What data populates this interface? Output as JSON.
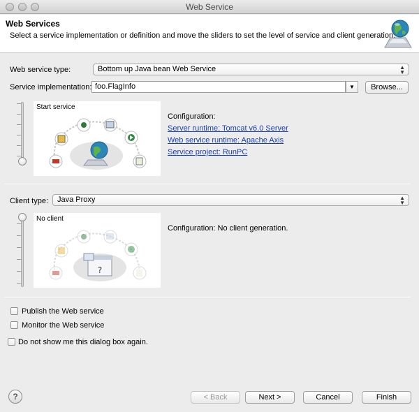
{
  "window": {
    "title": "Web Service",
    "colors": {
      "link": "#1a3fb5",
      "banner_bg": "#ffffff",
      "dialog_bg": "#ececec"
    }
  },
  "banner": {
    "title": "Web Services",
    "description": "Select a service implementation or definition and move the sliders to set the level of service and client generation.",
    "icon": "web-services-globe-icon"
  },
  "service": {
    "type_label": "Web service type:",
    "type_value": "Bottom up Java bean Web Service",
    "impl_label": "Service implementation:",
    "impl_value": "foo.FlagInfo",
    "browse_label": "Browse...",
    "slider_level": "Start service",
    "config_heading": "Configuration:",
    "server_runtime": "Server runtime: Tomcat v6.0 Server",
    "ws_runtime": "Web service runtime: Apache Axis",
    "service_project": "Service project: RunPC"
  },
  "client": {
    "type_label": "Client type:",
    "type_value": "Java Proxy",
    "slider_level": "No client",
    "config_text": "Configuration: No client generation."
  },
  "options": {
    "publish": "Publish the Web service",
    "monitor": "Monitor the Web service",
    "dont_show": "Do not show me this dialog box again."
  },
  "footer": {
    "help_symbol": "?",
    "back": "< Back",
    "next": "Next >",
    "cancel": "Cancel",
    "finish": "Finish"
  }
}
